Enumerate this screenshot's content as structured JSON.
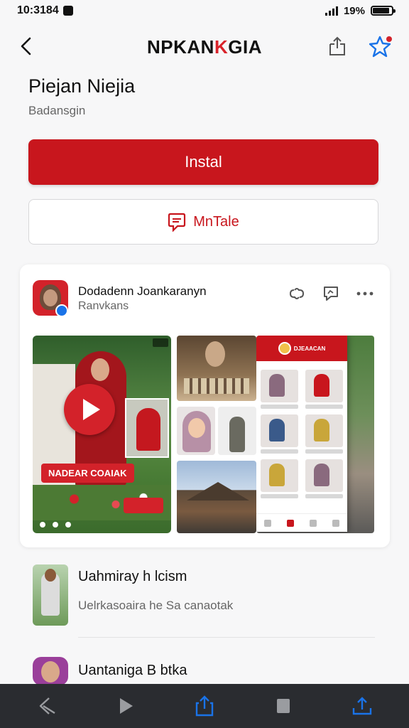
{
  "status_bar": {
    "time": "10:3184",
    "right_text": "19%"
  },
  "header": {
    "title_part1": "NPKAN",
    "title_accent": "K",
    "title_part2": "GIA"
  },
  "app": {
    "name": "Piejan Niejia",
    "subtitle": "Badansgin",
    "install_label": "Instal",
    "secondary_label": "MnTale"
  },
  "post": {
    "author": "Dodadenn Joankaranyn",
    "meta": "Ranvkans",
    "video_banner": "NADEAR COAIAK",
    "phone_title": "DJEAACAN"
  },
  "list": {
    "items": [
      {
        "title": "Uahmiray h lcism",
        "desc": "Uelrkasoaira he Sa canaotak"
      },
      {
        "title": "Uantaniga B btka"
      }
    ]
  },
  "colors": {
    "accent": "#c8161d",
    "bottom_bar": "#2a2c30",
    "bottom_active": "#1a73e8"
  },
  "icons": {
    "header": [
      "back-icon",
      "share-icon",
      "bookmark-star-icon"
    ],
    "post": [
      "link-icon",
      "comment-icon",
      "more-icon"
    ],
    "bottom": [
      "back-arrow-icon",
      "play-icon",
      "share-icon",
      "stop-icon",
      "upload-icon"
    ]
  }
}
